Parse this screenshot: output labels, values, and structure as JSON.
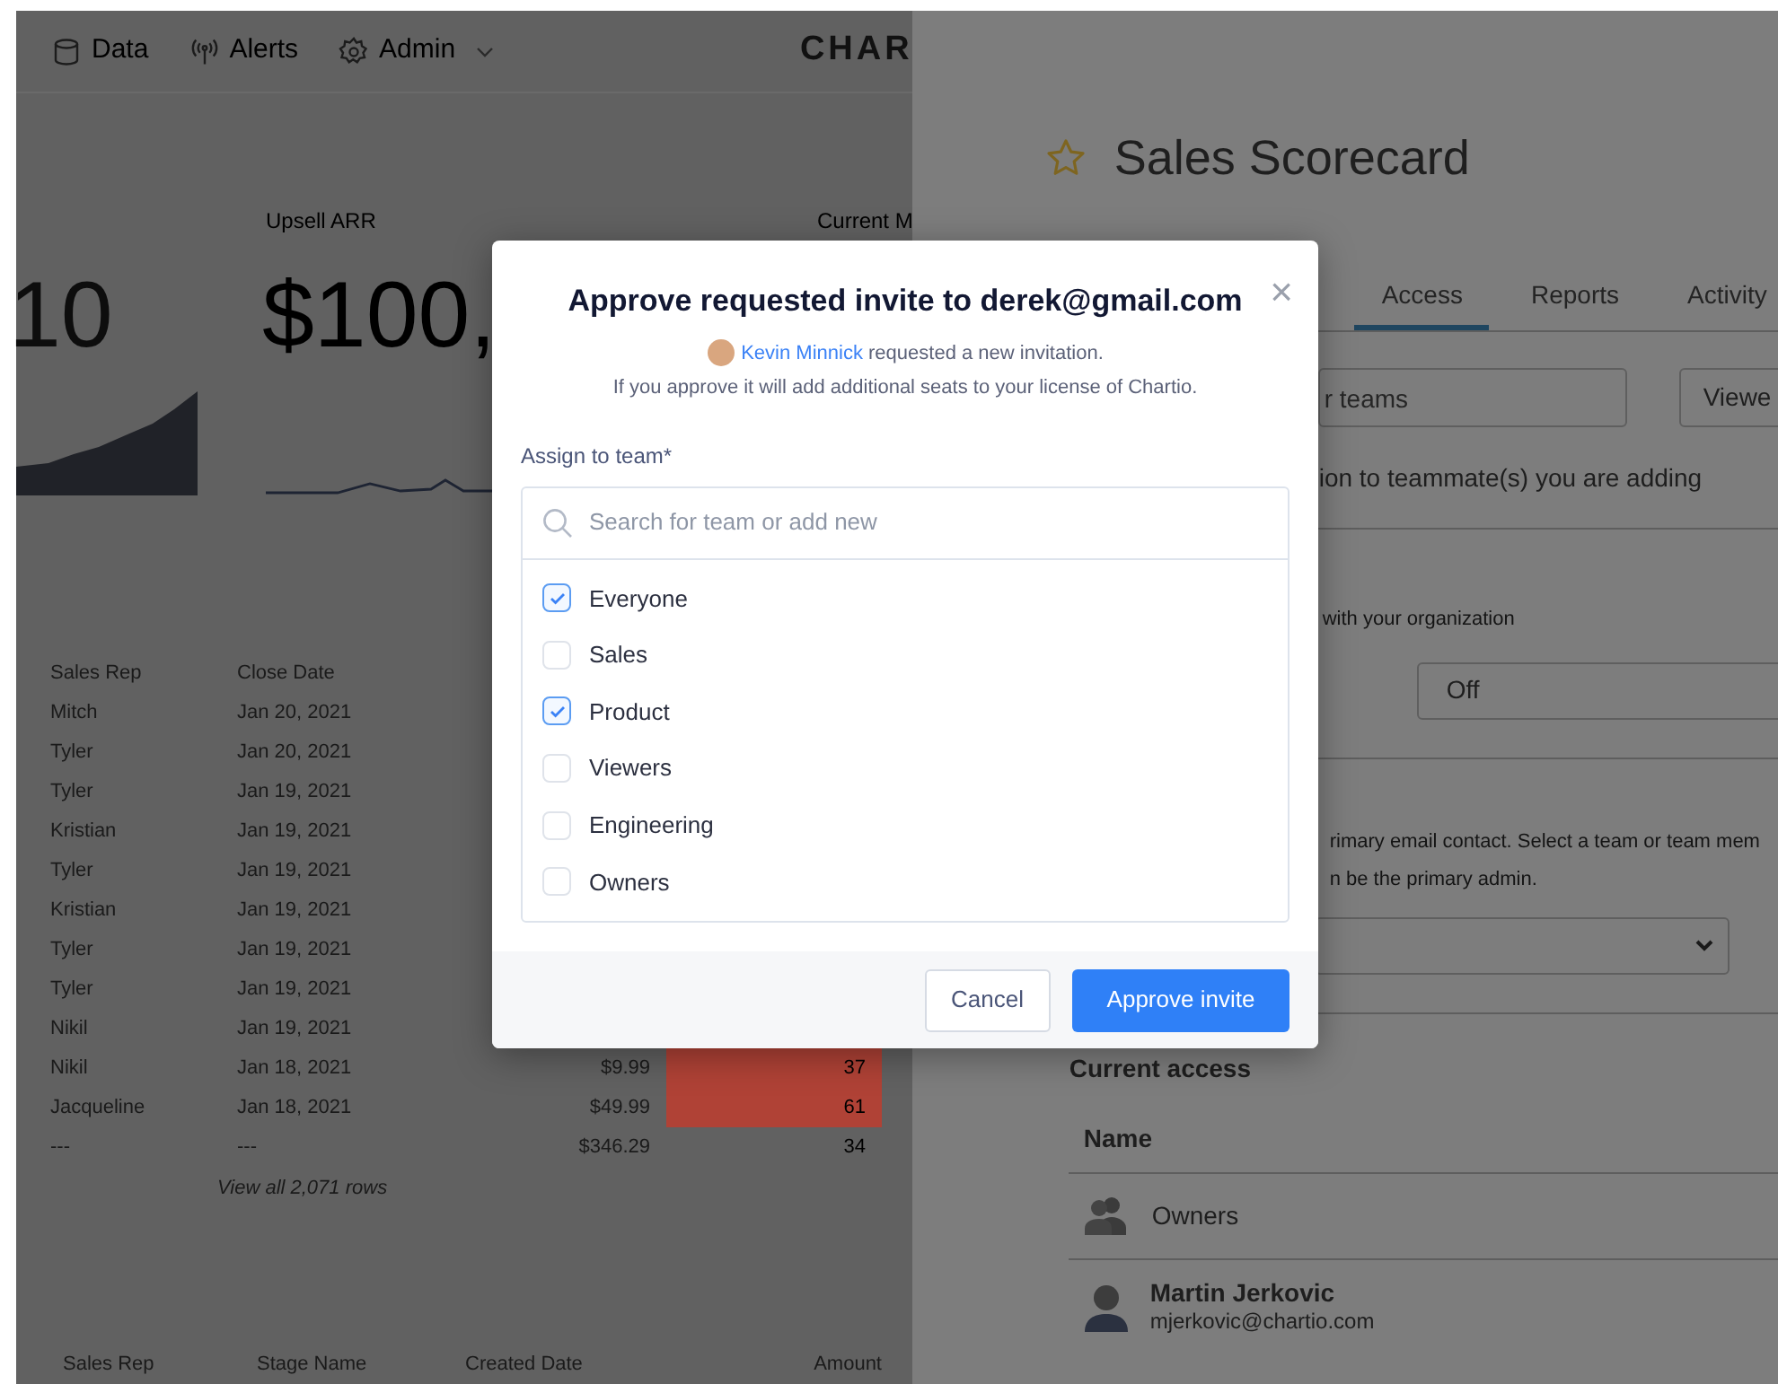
{
  "nav": {
    "items": [
      {
        "label": "Data",
        "has_menu": false
      },
      {
        "label": "Alerts",
        "has_menu": false
      },
      {
        "label": "Admin",
        "has_menu": true
      }
    ],
    "logo": "CHAR"
  },
  "kpis": [
    {
      "value": "10"
    },
    {
      "label": "Upsell ARR",
      "value": "$100,"
    },
    {
      "label": "Current M"
    }
  ],
  "deals_table": {
    "columns": [
      "Sales Rep",
      "Close Date"
    ],
    "rows": [
      {
        "cells": [
          "Mitch",
          "Jan 20, 2021"
        ]
      },
      {
        "cells": [
          "Tyler",
          "Jan 20, 2021"
        ]
      },
      {
        "cells": [
          "Tyler",
          "Jan 19, 2021"
        ]
      },
      {
        "cells": [
          "Kristian",
          "Jan 19, 2021"
        ]
      },
      {
        "cells": [
          "Tyler",
          "Jan 19, 2021"
        ]
      },
      {
        "cells": [
          "Kristian",
          "Jan 19, 2021"
        ]
      },
      {
        "cells": [
          "Tyler",
          "Jan 19, 2021"
        ]
      },
      {
        "cells": [
          "Tyler",
          "Jan 19, 2021"
        ]
      },
      {
        "cells": [
          "Nikil",
          "Jan 19, 2021"
        ]
      },
      {
        "cells": [
          "Nikil",
          "Jan 18, 2021",
          "$9.99",
          "37"
        ],
        "highlighted": true
      },
      {
        "cells": [
          "Jacqueline",
          "Jan 18, 2021",
          "$49.99",
          "61"
        ],
        "highlighted": true
      },
      {
        "cells": [
          "---",
          "---",
          "$346.29",
          "34"
        ],
        "highlighted": false
      }
    ],
    "view_all": "View all 2,071 rows"
  },
  "pipeline_table": {
    "columns": [
      "Sales Rep",
      "Stage Name",
      "Created Date",
      "Amount"
    ]
  },
  "dashboard": {
    "title": "Sales Scorecard",
    "starred": false,
    "tabs": [
      {
        "label": "Access",
        "selected": true
      },
      {
        "label": "Reports",
        "selected": false
      },
      {
        "label": "Activity",
        "selected": false
      }
    ],
    "invite_field": {
      "placeholder": "r teams"
    },
    "role_button": "Viewe",
    "invite_note": "ion to teammate(s) you are adding",
    "sharing_hint": "with your organization",
    "sharing_select": "Off",
    "primary_text": [
      "rimary email contact. Select a team or team mem",
      "n be the primary admin."
    ],
    "current_access": {
      "heading": "Current access",
      "column": "Name",
      "members": [
        {
          "kind": "team",
          "name": "Owners"
        },
        {
          "kind": "user",
          "name": "Martin Jerkovic",
          "email": "mjerkovic@chartio.com"
        }
      ]
    }
  },
  "modal": {
    "title": "Approve requested invite to derek@gmail.com",
    "close": "×",
    "requester": "Kevin Minnick",
    "request_text": "requested a new invitation.",
    "note": "If you approve it will add additional seats to your license of Chartio.",
    "field_label": "Assign to team*",
    "search": {
      "placeholder": "Search for team or add new"
    },
    "teams": [
      {
        "label": "Everyone",
        "checked": true
      },
      {
        "label": "Sales",
        "checked": false
      },
      {
        "label": "Product",
        "checked": true
      },
      {
        "label": "Viewers",
        "checked": false
      },
      {
        "label": "Engineering",
        "checked": false
      },
      {
        "label": "Owners",
        "checked": false
      }
    ],
    "buttons": {
      "cancel": "Cancel",
      "approve": "Approve invite"
    }
  }
}
